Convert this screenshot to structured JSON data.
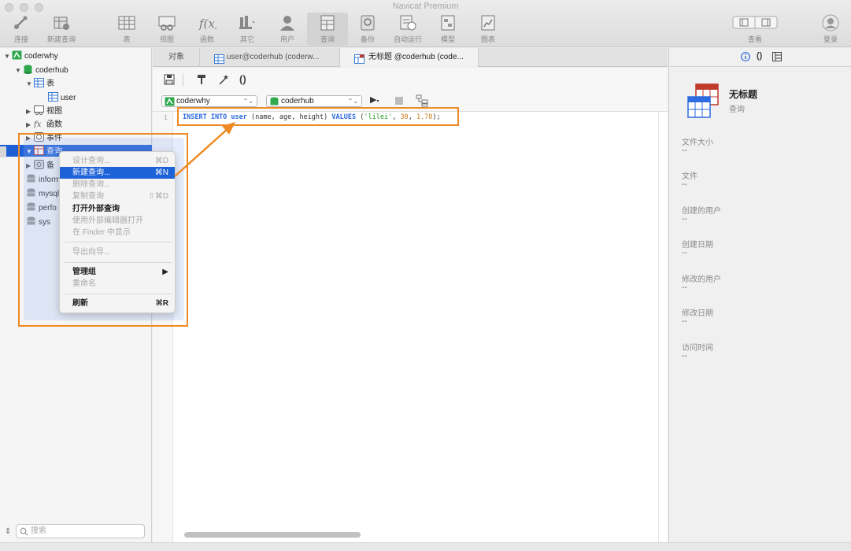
{
  "window": {
    "title": "Navicat Premium"
  },
  "toolbar": {
    "items": [
      {
        "label": "连接",
        "icon": "connection-icon"
      },
      {
        "label": "新建查询",
        "icon": "new-query-icon"
      },
      {
        "label": "表",
        "icon": "table-icon"
      },
      {
        "label": "视图",
        "icon": "view-icon"
      },
      {
        "label": "函数",
        "icon": "function-icon"
      },
      {
        "label": "其它",
        "icon": "other-icon"
      },
      {
        "label": "用户",
        "icon": "user-icon"
      },
      {
        "label": "查询",
        "icon": "query-icon"
      },
      {
        "label": "备份",
        "icon": "backup-icon"
      },
      {
        "label": "自动运行",
        "icon": "automation-icon"
      },
      {
        "label": "模型",
        "icon": "model-icon"
      },
      {
        "label": "图表",
        "icon": "chart-icon"
      },
      {
        "label": "查看",
        "icon": "view-toggle-icon"
      },
      {
        "label": "登录",
        "icon": "login-icon"
      }
    ],
    "active": "查询"
  },
  "sidebar": {
    "tree": [
      {
        "label": "coderwhy",
        "type": "connection"
      },
      {
        "label": "coderhub",
        "type": "database"
      },
      {
        "label": "表",
        "type": "folder-table"
      },
      {
        "label": "user",
        "type": "table"
      },
      {
        "label": "视图",
        "type": "folder-view"
      },
      {
        "label": "函数",
        "type": "folder-function"
      },
      {
        "label": "事件",
        "type": "folder-event"
      },
      {
        "label": "查询",
        "type": "folder-query"
      },
      {
        "label": "备",
        "type": "folder-backup"
      },
      {
        "label": "inform",
        "type": "database"
      },
      {
        "label": "mysql",
        "type": "database"
      },
      {
        "label": "perfo",
        "type": "database"
      },
      {
        "label": "sys",
        "type": "database"
      }
    ],
    "search_placeholder": "搜索"
  },
  "tabs": [
    {
      "label": "对象"
    },
    {
      "label": "user@coderhub (coderw..."
    },
    {
      "label": "无标题 @coderhub (code..."
    }
  ],
  "editor": {
    "connection": "coderwhy",
    "database": "coderhub",
    "line_number": "1",
    "code": {
      "kw1": "INSERT INTO",
      "table": "user",
      "cols": "(name, age, height)",
      "kw2": "VALUES",
      "open": "(",
      "s1": "'lilei'",
      "c1": ",",
      "n1": "30",
      "c2": ",",
      "n2": "1.78",
      "close": ");"
    }
  },
  "context_menu": {
    "items": [
      {
        "label": "设计查询...",
        "shortcut": "⌘D",
        "enabled": false
      },
      {
        "label": "新建查询...",
        "shortcut": "⌘N",
        "enabled": true,
        "highlighted": true
      },
      {
        "label": "删除查询...",
        "shortcut": "",
        "enabled": false
      },
      {
        "label": "复制查询",
        "shortcut": "⇧⌘D",
        "enabled": false
      },
      {
        "label": "打开外部查询",
        "shortcut": "",
        "enabled": true
      },
      {
        "label": "使用外部编辑器打开",
        "shortcut": "",
        "enabled": false
      },
      {
        "label": "在 Finder 中显示",
        "shortcut": "",
        "enabled": false
      },
      {
        "label": "导出向导...",
        "shortcut": "",
        "enabled": false
      },
      {
        "label": "管理组",
        "shortcut": "▶",
        "enabled": true
      },
      {
        "label": "重命名",
        "shortcut": "",
        "enabled": false
      },
      {
        "label": "刷新",
        "shortcut": "⌘R",
        "enabled": true
      }
    ]
  },
  "info_panel": {
    "title": "无标题",
    "subtitle": "查询",
    "properties": [
      {
        "label": "文件大小",
        "value": "--"
      },
      {
        "label": "文件",
        "value": "--"
      },
      {
        "label": "创建的用户",
        "value": "--"
      },
      {
        "label": "创建日期",
        "value": "--"
      },
      {
        "label": "修改的用户",
        "value": "--"
      },
      {
        "label": "修改日期",
        "value": "--"
      },
      {
        "label": "访问时间",
        "value": "--"
      }
    ]
  },
  "colors": {
    "selection": "#1e5fd5",
    "annotation": "#ee8a25",
    "keyword": "#2c6be0",
    "string": "#1a9a1a",
    "number": "#d07a1a"
  }
}
